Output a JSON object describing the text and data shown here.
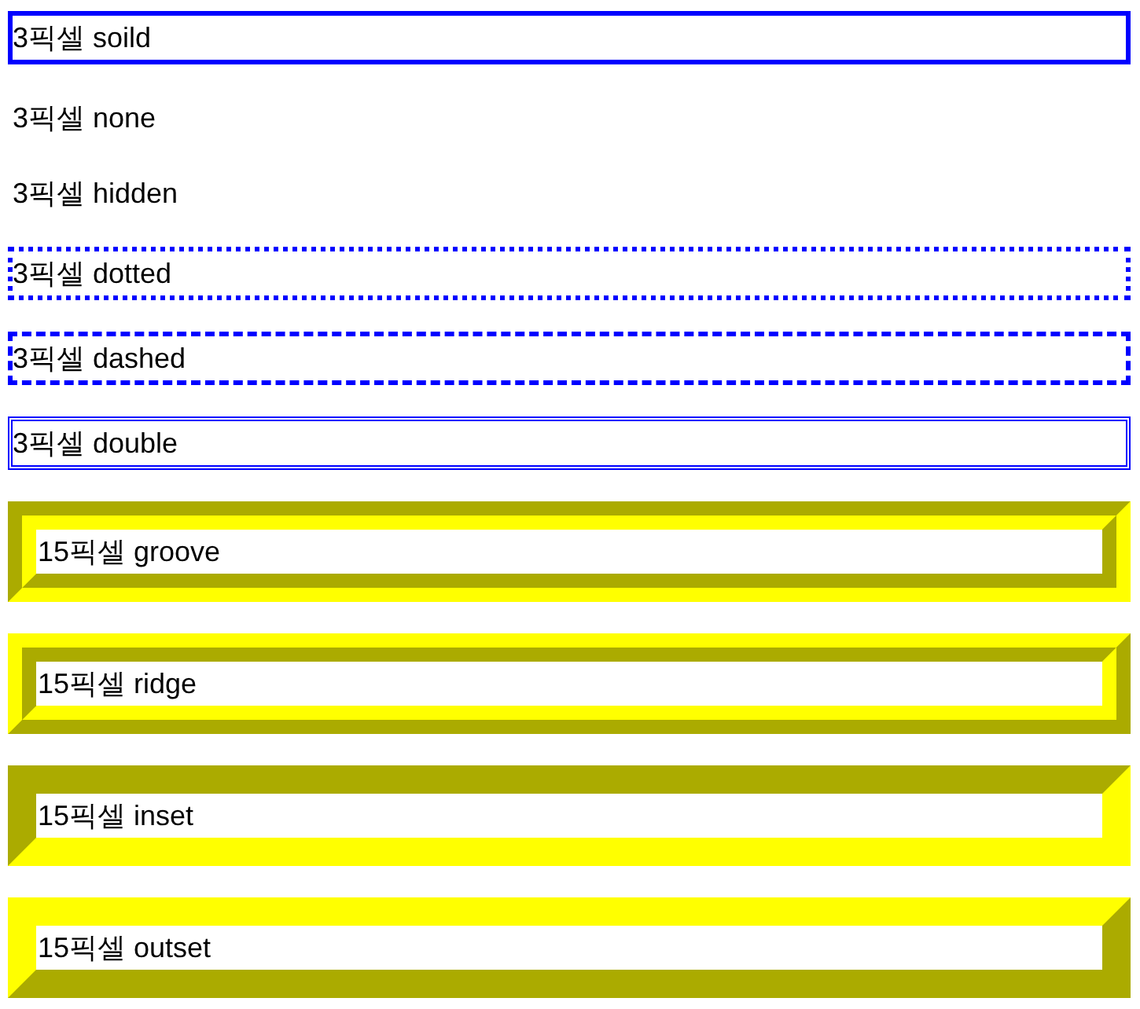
{
  "thin_boxes": [
    {
      "text": "3픽셀 soild",
      "kind": "solid",
      "color": "#0000ff"
    },
    {
      "text": "3픽셀 none",
      "kind": "none"
    },
    {
      "text": "3픽셀 hidden",
      "kind": "hidden"
    },
    {
      "text": "3픽셀 dotted",
      "kind": "dotted",
      "color": "#0000ff"
    },
    {
      "text": "3픽셀 dashed",
      "kind": "dashed",
      "color": "#0000ff"
    },
    {
      "text": "3픽셀 double",
      "kind": "double",
      "color": "#0000ff"
    }
  ],
  "thick_boxes": [
    {
      "text": "15픽셀 groove",
      "kind": "groove",
      "color": "#ffff00"
    },
    {
      "text": "15픽셀 ridge",
      "kind": "ridge",
      "color": "#ffff00"
    },
    {
      "text": "15픽셀 inset",
      "kind": "inset",
      "color": "#ffff00"
    },
    {
      "text": "15픽셀 outset",
      "kind": "outset",
      "color": "#ffff00"
    }
  ]
}
